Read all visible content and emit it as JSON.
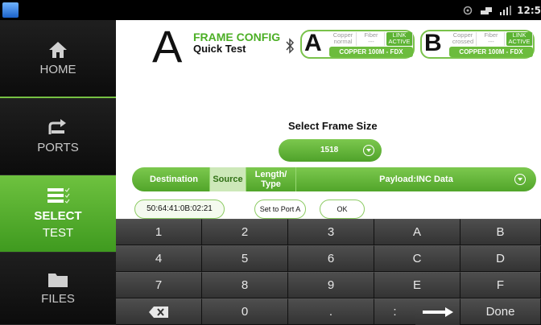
{
  "statusbar": {
    "time": "12:5",
    "icons": [
      "app-icon",
      "sync-icon",
      "wifi-icon",
      "signal-icon"
    ]
  },
  "sidebar": {
    "items": [
      {
        "label": "HOME",
        "icon": "home-icon"
      },
      {
        "label": "PORTS",
        "icon": "ports-icon"
      },
      {
        "label_line1": "SELECT",
        "label_line2": "TEST",
        "icon": "list-check-icon",
        "active": true
      },
      {
        "label": "FILES",
        "icon": "folder-icon"
      }
    ]
  },
  "header": {
    "big_letter": "A",
    "title": "FRAME CONFIG",
    "subtitle": "Quick Test",
    "ports": [
      {
        "letter": "A",
        "copper": [
          "Copper",
          "normal"
        ],
        "fiber": [
          "Fiber",
          "---"
        ],
        "link": [
          "LINK",
          "ACTIVE"
        ],
        "status": "COPPER 100M  - FDX"
      },
      {
        "letter": "B",
        "copper": [
          "Copper",
          "crossed"
        ],
        "fiber": [
          "Fiber",
          "---"
        ],
        "link": [
          "LINK",
          "ACTIVE"
        ],
        "status": "COPPER 100M  - FDX"
      }
    ]
  },
  "frame_size": {
    "label": "Select Frame Size",
    "value": "1518"
  },
  "tabs": {
    "destination": "Destination",
    "source": "Source",
    "length_type_1": "Length/",
    "length_type_2": "Type",
    "payload": "Payload:INC Data"
  },
  "mac": {
    "value": "50:64:41:0B:02:21"
  },
  "buttons": {
    "set_to_port_a": "Set to Port A",
    "ok": "OK"
  },
  "keyboard": {
    "rows": [
      [
        "1",
        "2",
        "3",
        "A",
        "B"
      ],
      [
        "4",
        "5",
        "6",
        "C",
        "D"
      ],
      [
        "7",
        "8",
        "9",
        "E",
        "F"
      ],
      [
        "",
        "0",
        ".",
        ":",
        "",
        "",
        "Done"
      ]
    ],
    "done": "Done"
  },
  "colors": {
    "accent_green": "#6ec23f",
    "sidebar_bg": "#111111",
    "key_bg": "#3c3c3c"
  }
}
